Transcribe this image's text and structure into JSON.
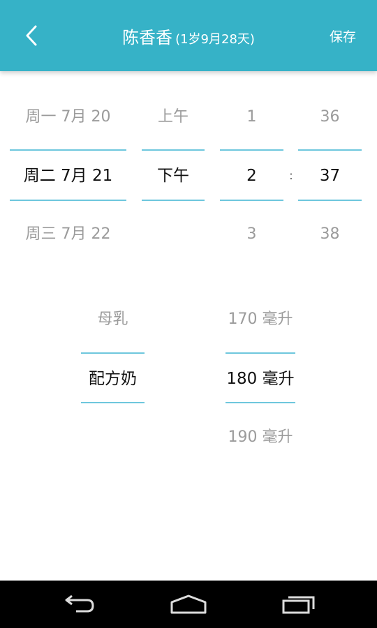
{
  "header": {
    "name": "陈香香",
    "age": "(1岁9月28天)",
    "save_label": "保存"
  },
  "time_picker": {
    "date": {
      "items": [
        "周一 7月 20",
        "周二 7月 21",
        "周三 7月 22"
      ],
      "selected": "周二 7月 21"
    },
    "ampm": {
      "items": [
        "上午",
        "下午",
        ""
      ],
      "selected": "下午"
    },
    "hour": {
      "items": [
        "1",
        "2",
        "3"
      ],
      "selected": "2"
    },
    "separator": ":",
    "minute": {
      "items": [
        "36",
        "37",
        "38"
      ],
      "selected": "37"
    }
  },
  "feed_picker": {
    "type": {
      "items": [
        "母乳",
        "配方奶",
        ""
      ],
      "selected": "配方奶"
    },
    "amount": {
      "items": [
        "170 毫升",
        "180 毫升",
        "190 毫升"
      ],
      "selected": "180 毫升"
    }
  },
  "icons": {
    "back": "chevron-left-icon",
    "nav_back": "back-arrow-icon",
    "nav_home": "home-icon",
    "nav_recents": "recent-apps-icon"
  },
  "colors": {
    "header_bg": "#36b2c7",
    "divider": "#6ec7dd",
    "nav_bg": "#000000"
  }
}
